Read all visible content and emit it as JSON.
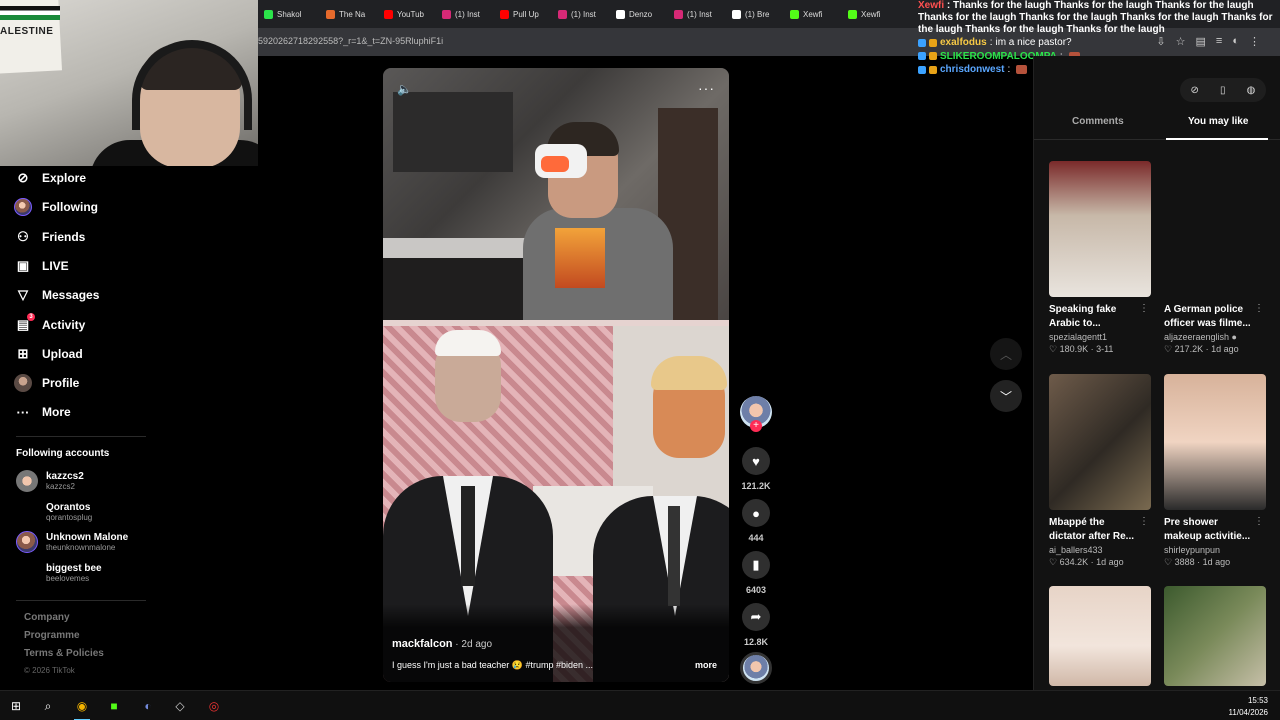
{
  "browser": {
    "tabs": [
      {
        "label": "Shakol",
        "color": "#2be34a"
      },
      {
        "label": "The Na",
        "color": "#e66a2c"
      },
      {
        "label": "YouTub",
        "color": "#ff0000"
      },
      {
        "label": "(1) Inst",
        "color": "#d62976"
      },
      {
        "label": "Pull Up",
        "color": "#ff0000"
      },
      {
        "label": "(1) Inst",
        "color": "#d62976"
      },
      {
        "label": "Denzo",
        "color": "#ffffff"
      },
      {
        "label": "(1) Inst",
        "color": "#d62976"
      },
      {
        "label": "(1) Bre",
        "color": "#ffffff"
      },
      {
        "label": "Xewfi",
        "color": "#53fc18"
      },
      {
        "label": "Xewfi",
        "color": "#53fc18"
      }
    ],
    "url": "5920262718292558?_r=1&_t=ZN-95RluphiF1i"
  },
  "chat": {
    "long_message_author": "Xewfi",
    "long_message": "Thanks for the laugh Thanks for the laugh Thanks for the laugh Thanks for the laugh Thanks for the laugh Thanks for the laugh Thanks for the laugh Thanks for the laugh Thanks for the laugh",
    "lines": [
      {
        "user": "exalfodus",
        "sep": " : ",
        "text": "im a nice pastor?",
        "name_class": "name-yel"
      },
      {
        "user": "SLIKEROOMPALOOMPA",
        "sep": " : ",
        "text": "",
        "name_class": "name-grn"
      },
      {
        "user": "chrisdonwest",
        "sep": " : ",
        "text": "",
        "name_class": "name-blu"
      }
    ]
  },
  "webcam": {
    "poster_text": "ALESTINE"
  },
  "sidebar": {
    "items": [
      {
        "label": "Explore",
        "icon": "compass-icon"
      },
      {
        "label": "Following",
        "icon": "avatar-icon"
      },
      {
        "label": "Friends",
        "icon": "friends-icon"
      },
      {
        "label": "LIVE",
        "icon": "live-icon"
      },
      {
        "label": "Messages",
        "icon": "paper-plane-icon"
      },
      {
        "label": "Activity",
        "icon": "activity-icon",
        "badge": "3"
      },
      {
        "label": "Upload",
        "icon": "upload-icon"
      },
      {
        "label": "Profile",
        "icon": "profile-avatar-icon"
      },
      {
        "label": "More",
        "icon": "more-icon"
      }
    ],
    "following_title": "Following accounts",
    "accounts": [
      {
        "name": "kazzcs2",
        "handle": "kazzcs2"
      },
      {
        "name": "Qorantos",
        "handle": "qorantosplug"
      },
      {
        "name": "Unknown Malone",
        "handle": "theunknownmalone"
      },
      {
        "name": "biggest bee",
        "handle": "beelovemes"
      }
    ],
    "footer": {
      "company": "Company",
      "programme": "Programme",
      "terms": "Terms & Policies",
      "copyright": "© 2026 TikTok"
    }
  },
  "video": {
    "author": "mackfalcon",
    "date": " · 2d ago",
    "description": "I guess I'm just a bad teacher 😢 #trump #biden ...",
    "more": "more",
    "likes": "121.2K",
    "comments": "444",
    "saves": "6403",
    "shares": "12.8K"
  },
  "right_panel": {
    "tab_comments": "Comments",
    "tab_you_may_like": "You may like",
    "cards": [
      {
        "title": "Speaking fake Arabic to...",
        "author": "spezialagentt1",
        "stats": "♡ 180.9K · 3-11",
        "bg": "linear-gradient(#7a2a2a, #c7b8a8 40%, #e9e4de)"
      },
      {
        "title": "A German police officer was filme...",
        "author": "aljazeeraenglish ●",
        "stats": "♡ 217.2K · 1d ago",
        "bg": "#121212"
      },
      {
        "title": "Mbappé the dictator after Re...",
        "author": "ai_ballers433",
        "stats": "♡ 634.2K · 1d ago",
        "bg": "linear-gradient(135deg, #6e5b4a, #2f2a24 55%, #7a6a50)"
      },
      {
        "title": "Pre shower makeup activitie...",
        "author": "shirleypunpun",
        "stats": "♡ 3888 · 1d ago",
        "bg": "linear-gradient(#d7b29a, #f0d4c2 50%, #2a2a2a)"
      },
      {
        "title": "",
        "author": "",
        "stats": "",
        "bg": "linear-gradient(#e7d4c7, #f2e5dc 60%, #d0b8a8)"
      },
      {
        "title": "",
        "author": "",
        "stats": "",
        "bg": "linear-gradient(135deg, #3c5a2e, #7a8a5a 50%, #c6bfa8)"
      }
    ]
  },
  "taskbar": {
    "time": "15:53",
    "date": "11/04/2026"
  }
}
